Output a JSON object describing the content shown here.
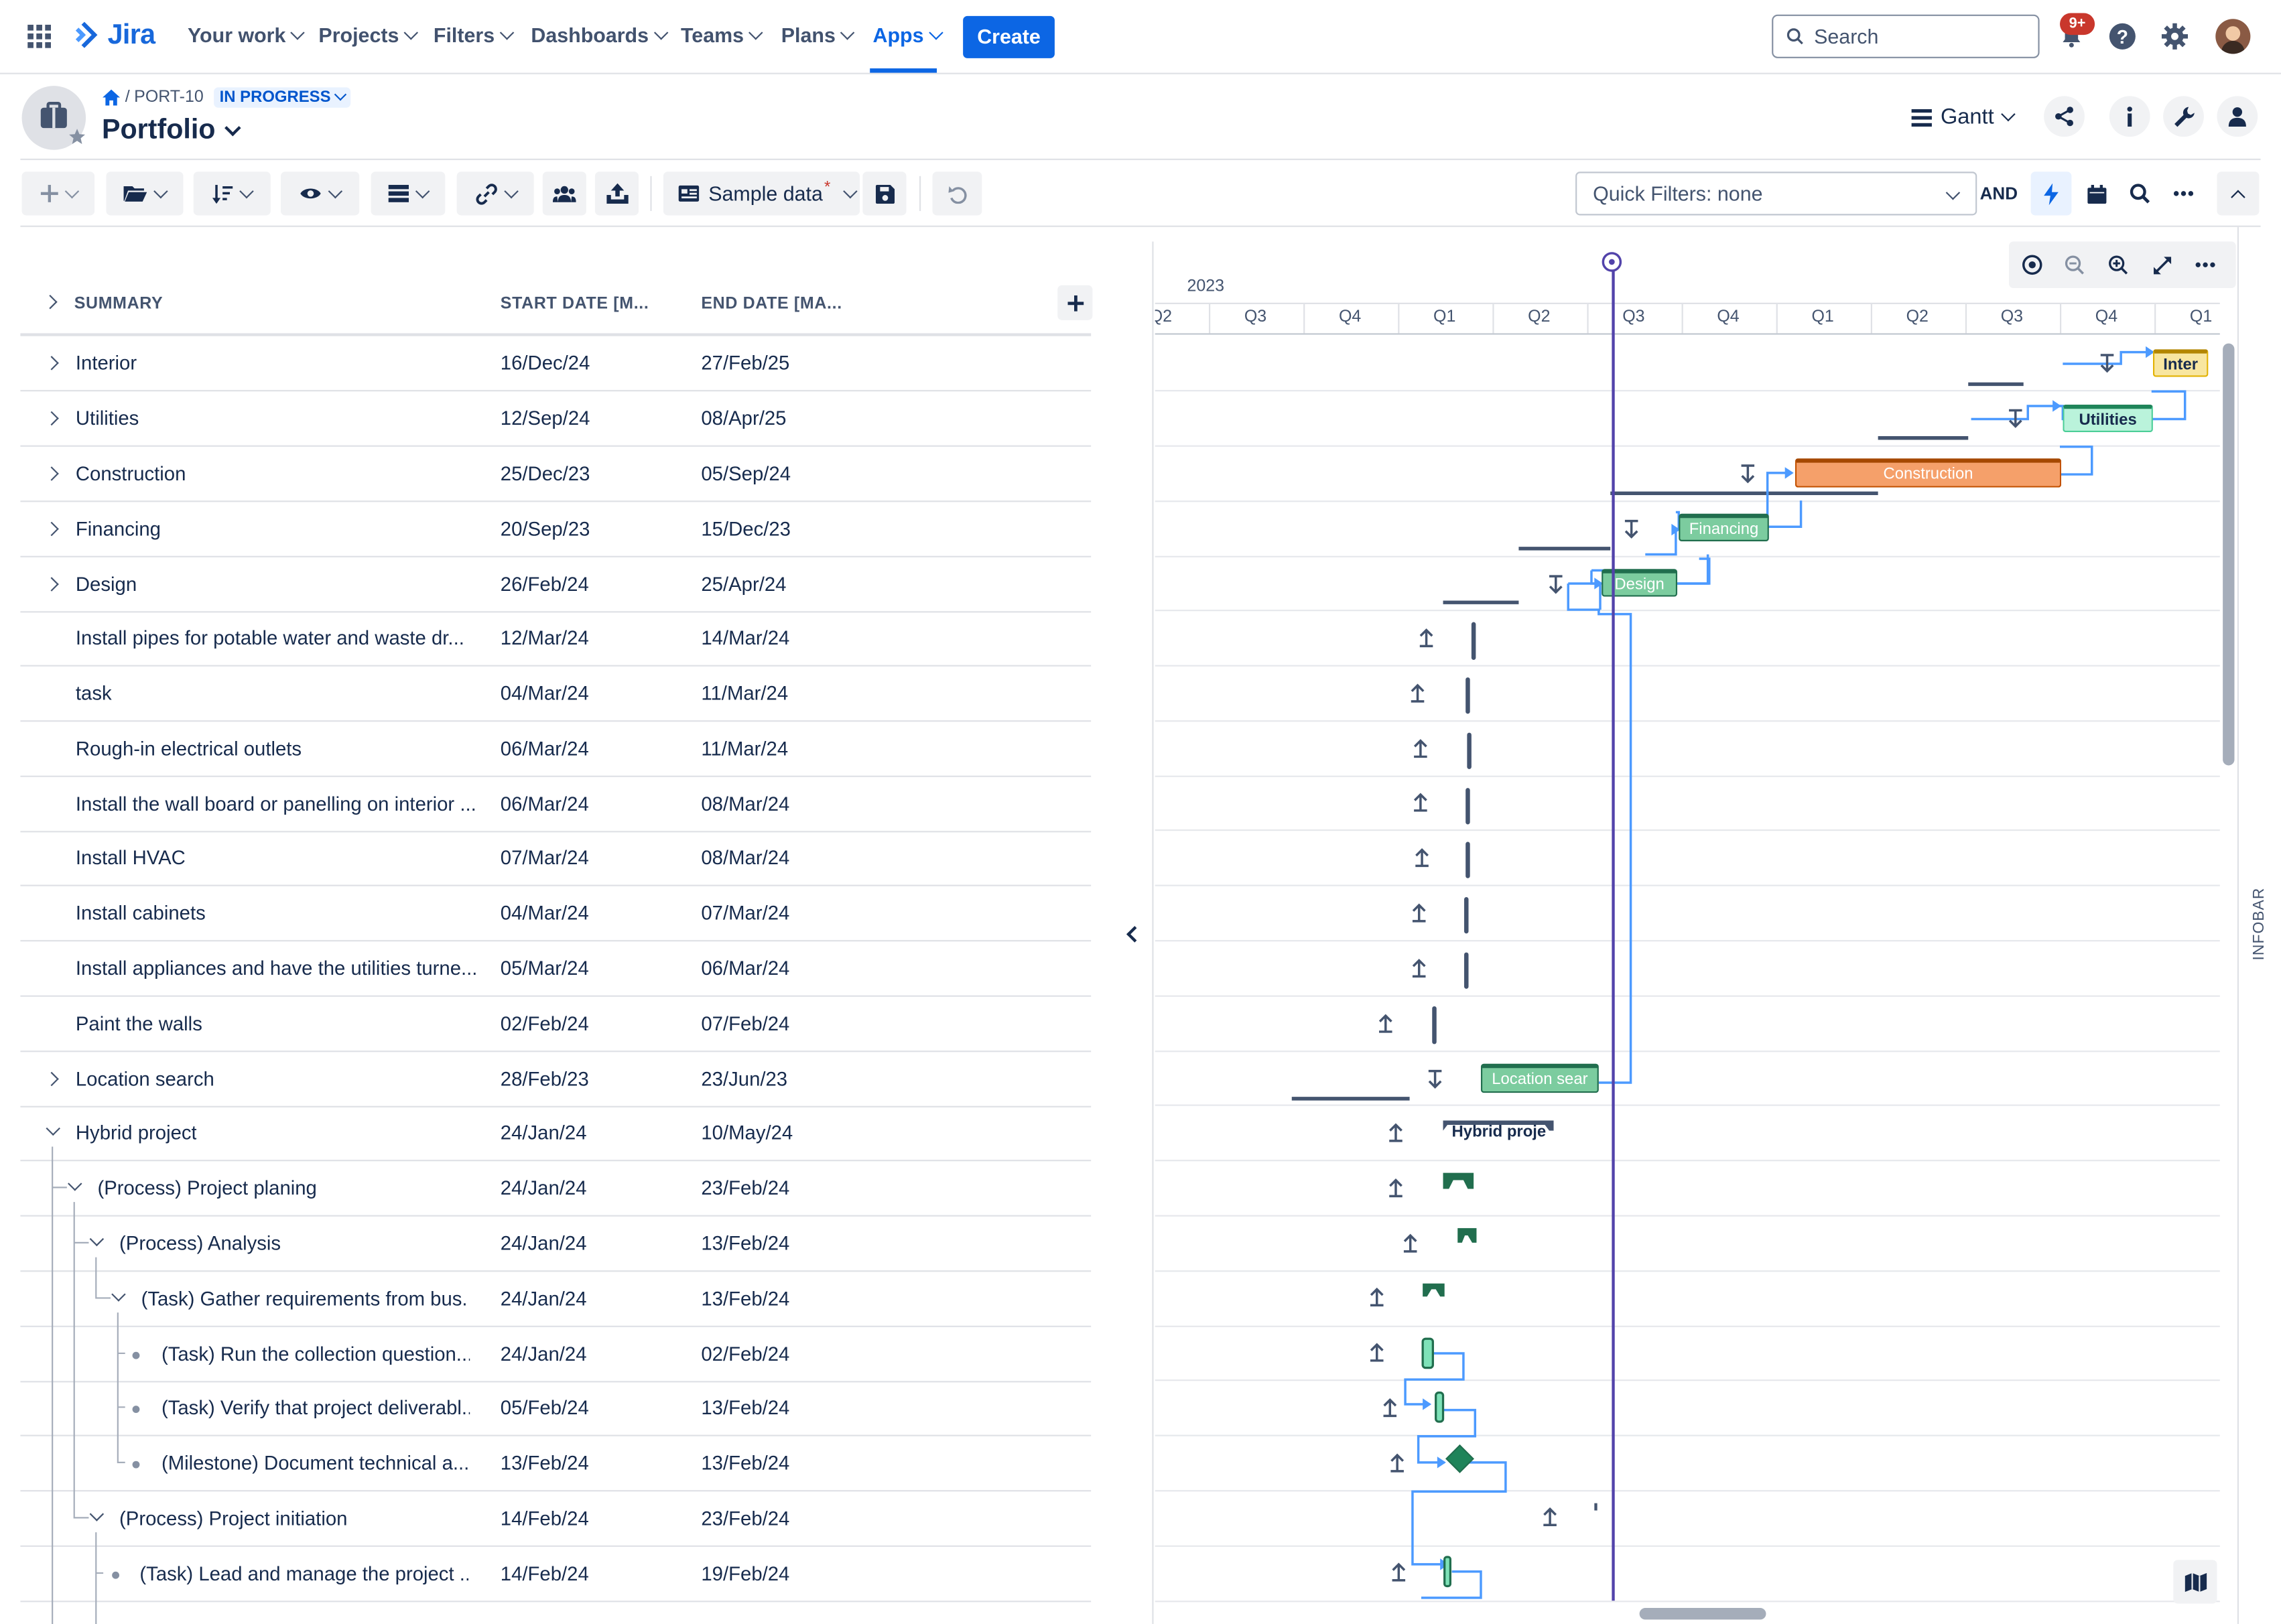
{
  "nav": {
    "app_name": "Jira",
    "items": [
      "Your work",
      "Projects",
      "Filters",
      "Dashboards",
      "Teams",
      "Plans",
      "Apps"
    ],
    "create_label": "Create",
    "search_placeholder": "Search",
    "notification_badge": "9+"
  },
  "header": {
    "breadcrumb_key": "PORT-10",
    "status": "IN PROGRESS",
    "title": "Portfolio",
    "view_label": "Gantt"
  },
  "toolbar": {
    "sample_data_label": "Sample data",
    "sample_data_marker": "*",
    "quick_filters_label": "Quick Filters: none",
    "and_label": "AND"
  },
  "grid": {
    "columns": [
      "SUMMARY",
      "START DATE [M...",
      "END DATE [MA..."
    ],
    "rows": [
      {
        "summary": "Interior",
        "start": "16/Dec/24",
        "end": "27/Feb/25"
      },
      {
        "summary": "Utilities",
        "start": "12/Sep/24",
        "end": "08/Apr/25"
      },
      {
        "summary": "Construction",
        "start": "25/Dec/23",
        "end": "05/Sep/24"
      },
      {
        "summary": "Financing",
        "start": "20/Sep/23",
        "end": "15/Dec/23"
      },
      {
        "summary": "Design",
        "start": "26/Feb/24",
        "end": "25/Apr/24"
      },
      {
        "summary": "Install pipes for potable water and waste dr...",
        "start": "12/Mar/24",
        "end": "14/Mar/24"
      },
      {
        "summary": "task",
        "start": "04/Mar/24",
        "end": "11/Mar/24"
      },
      {
        "summary": "Rough-in electrical outlets",
        "start": "06/Mar/24",
        "end": "11/Mar/24"
      },
      {
        "summary": "Install the wall board or panelling on interior ...",
        "start": "06/Mar/24",
        "end": "08/Mar/24"
      },
      {
        "summary": "Install HVAC",
        "start": "07/Mar/24",
        "end": "08/Mar/24"
      },
      {
        "summary": "Install cabinets",
        "start": "04/Mar/24",
        "end": "07/Mar/24"
      },
      {
        "summary": "Install appliances and have the utilities turne...",
        "start": "05/Mar/24",
        "end": "06/Mar/24"
      },
      {
        "summary": "Paint the walls",
        "start": "02/Feb/24",
        "end": "07/Feb/24"
      },
      {
        "summary": "Location search",
        "start": "28/Feb/23",
        "end": "23/Jun/23"
      },
      {
        "summary": "Hybrid project",
        "start": "24/Jan/24",
        "end": "10/May/24"
      },
      {
        "summary": "(Process) Project planing",
        "start": "24/Jan/24",
        "end": "23/Feb/24"
      },
      {
        "summary": "(Process) Analysis",
        "start": "24/Jan/24",
        "end": "13/Feb/24"
      },
      {
        "summary": "(Task) Gather requirements from bus...",
        "start": "24/Jan/24",
        "end": "13/Feb/24"
      },
      {
        "summary": "(Task) Run the collection question...",
        "start": "24/Jan/24",
        "end": "02/Feb/24"
      },
      {
        "summary": "(Task) Verify that project deliverabl...",
        "start": "05/Feb/24",
        "end": "13/Feb/24"
      },
      {
        "summary": "(Milestone) Document technical a...",
        "start": "13/Feb/24",
        "end": "13/Feb/24"
      },
      {
        "summary": "(Process) Project initiation",
        "start": "14/Feb/24",
        "end": "23/Feb/24"
      },
      {
        "summary": "(Task) Lead and manage the project ...",
        "start": "14/Feb/24",
        "end": "19/Feb/24"
      }
    ]
  },
  "gantt": {
    "year_label": "2023",
    "quarters": [
      "Q2",
      "Q3",
      "Q4",
      "Q1",
      "Q2",
      "Q3",
      "Q4",
      "Q1",
      "Q2",
      "Q3",
      "Q4",
      "Q1"
    ],
    "bar_labels": {
      "interior": "Inter",
      "utilities": "Utilities",
      "construction": "Construction",
      "financing": "Financing",
      "design": "Design",
      "location": "Location sear",
      "hybrid": "Hybrid proje"
    },
    "infobar_label": "INFOBAR"
  },
  "colors": {
    "accent": "#0c66e4",
    "today_line": "#5243aa",
    "status": "#0055cc",
    "dependency": "#4c9aff"
  }
}
